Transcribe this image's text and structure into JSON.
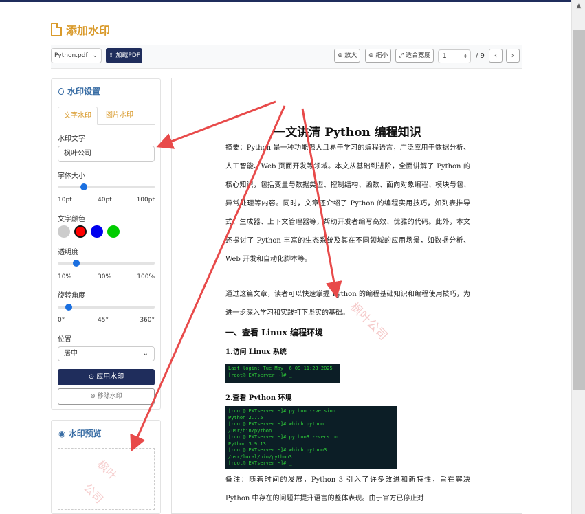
{
  "header": {
    "title": "添加水印"
  },
  "toolbar": {
    "file_select": "Python.pdf",
    "load_btn": "加载PDF",
    "zoom_in": "放大",
    "zoom_out": "缩小",
    "fit_width": "适合宽度",
    "page_value": "1",
    "page_total": "/ 9",
    "prev_icon": "‹",
    "next_icon": "›"
  },
  "settings": {
    "title": "水印设置",
    "tab_text": "文字水印",
    "tab_image": "图片水印",
    "text_label": "水印文字",
    "text_value": "枫叶公司",
    "size_label": "字体大小",
    "size_ticks": [
      "10pt",
      "40pt",
      "100pt"
    ],
    "size_value_fraction": 0.27,
    "color_label": "文字颜色",
    "colors": [
      "#cccccc",
      "#ff0000",
      "#0000ee",
      "#00cc00"
    ],
    "selected_color": "#ff0000",
    "opacity_label": "透明度",
    "opacity_ticks": [
      "10%",
      "30%",
      "100%"
    ],
    "opacity_value_fraction": 0.19,
    "rotation_label": "旋转角度",
    "rotation_ticks": [
      "0°",
      "45°",
      "360°"
    ],
    "rotation_value_fraction": 0.11,
    "position_label": "位置",
    "position_value": "居中",
    "apply_btn": "应用水印",
    "remove_btn": "移除水印"
  },
  "preview": {
    "title": "水印预览",
    "wm_line1": "枫叶",
    "wm_line2": "公司"
  },
  "document": {
    "title": "一文讲清 Python 编程知识",
    "abstract": "摘要：Python 是一种功能强大且易于学习的编程语言，广泛应用于数据分析、人工智能、Web 页面开发等领域。本文从基础到进阶，全面讲解了 Python 的核心知识，包括变量与数据类型、控制结构、函数、面向对象编程、模块与包、异常处理等内容。同时，文章还介绍了 Python 的编程实用技巧，如列表推导式、生成器、上下文管理器等，帮助开发者编写高效、优雅的代码。此外，本文还探讨了 Python 丰富的生态系统及其在不同领域的应用场景，如数据分析、Web 开发和自动化脚本等。",
    "intro": "通过这篇文章，读者可以快速掌握 Python 的编程基础知识和编程使用技巧，为进一步深入学习和实践打下坚实的基础。",
    "section1": "一、查看 Linux 编程环境",
    "sub1": "1.访问 Linux 系统",
    "term1": "Last login: Tue May  6 09:11:28 2025\n[root@ EXTserver ~]# _",
    "sub2": "2.查看 Python 环境",
    "term2": "[root@ EXTserver ~]# python --version\nPython 2.7.5\n[root@ EXTserver ~]# which python\n/usr/bin/python\n[root@ EXTserver ~]# python3 --version\nPython 3.9.13\n[root@ EXTserver ~]# which python3\n/usr/local/bin/python3\n[root@ EXTserver ~]# _",
    "note": "备注：随着时间的发展，Python 3 引入了许多改进和新特性，旨在解决 Python 中存在的问题并提升语言的整体表现。由于官方已停止对",
    "watermark": "枫叶公司"
  }
}
